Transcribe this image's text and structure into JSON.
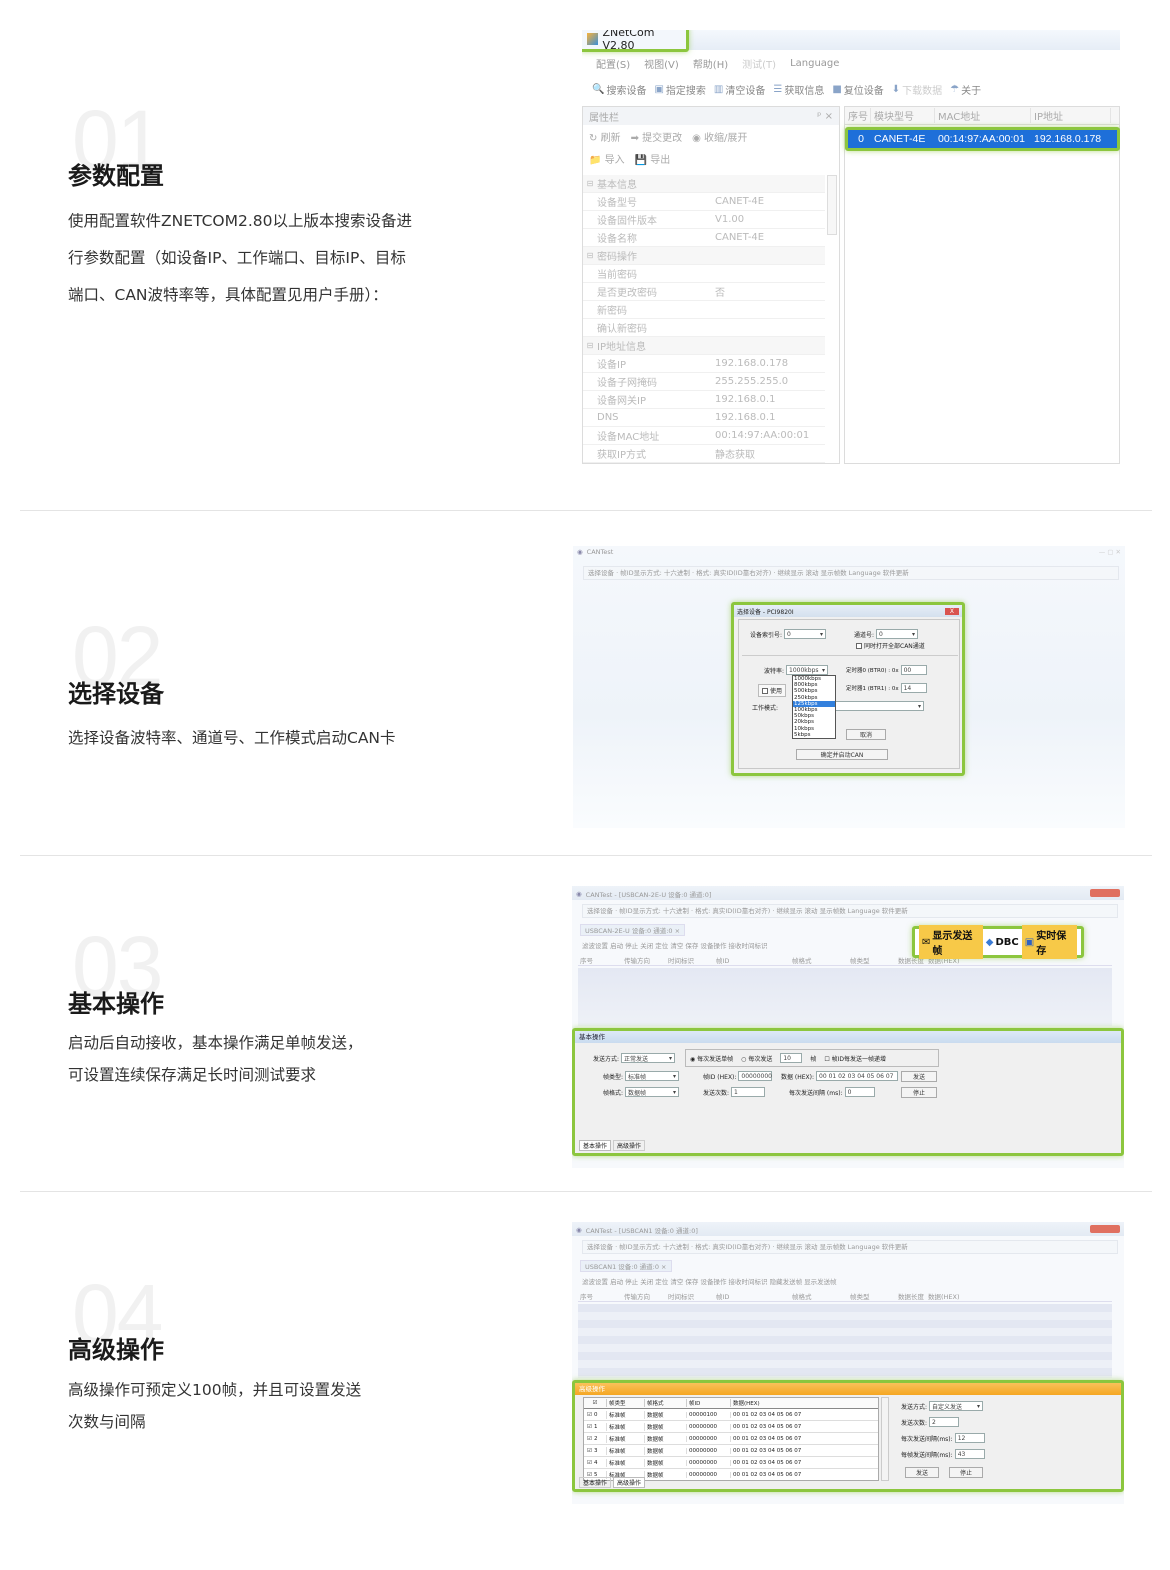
{
  "sections": [
    {
      "num": "01",
      "title": "参数配置",
      "desc": [
        "使用配置软件ZNETCOM2.80以上版本搜索设备进",
        "行参数配置（如设备IP、工作端口、目标IP、目标",
        "端口、CAN波特率等，具体配置见用户手册）："
      ]
    },
    {
      "num": "02",
      "title": "选择设备",
      "desc": [
        "选择设备波特率、通道号、工作模式启动CAN卡"
      ]
    },
    {
      "num": "03",
      "title": "基本操作",
      "desc": [
        "启动后自动接收，基本操作满足单帧发送，",
        "可设置连续保存满足长时间测试要求"
      ]
    },
    {
      "num": "04",
      "title": "高级操作",
      "desc": [
        "高级操作可预定义100帧，并且可设置发送",
        "次数与间隔"
      ]
    }
  ],
  "znet": {
    "title": "ZNetCom V2.80",
    "menu": [
      "配置(S)",
      "视图(V)",
      "帮助(H)",
      "测试(T)",
      "Language"
    ],
    "toolbar": [
      "搜索设备",
      "指定搜索",
      "清空设备",
      "获取信息",
      "复位设备",
      "下载数据",
      "关于"
    ],
    "panel_title": "属性栏",
    "panel_close": "ᵖ ×",
    "panel_tools": [
      "刷新",
      "提交更改",
      "收缩/展开"
    ],
    "panel_tools2": [
      "导入",
      "导出"
    ],
    "props": [
      {
        "group": "基本信息"
      },
      {
        "k": "设备型号",
        "v": "CANET-4E"
      },
      {
        "k": "设备固件版本",
        "v": "V1.00"
      },
      {
        "k": "设备名称",
        "v": "CANET-4E"
      },
      {
        "group": "密码操作"
      },
      {
        "k": "当前密码",
        "v": ""
      },
      {
        "k": "是否更改密码",
        "v": "否"
      },
      {
        "k": "新密码",
        "v": ""
      },
      {
        "k": "确认新密码",
        "v": ""
      },
      {
        "group": "IP地址信息"
      },
      {
        "k": "设备IP",
        "v": "192.168.0.178"
      },
      {
        "k": "设备子网掩码",
        "v": "255.255.255.0"
      },
      {
        "k": "设备网关IP",
        "v": "192.168.0.1"
      },
      {
        "k": "DNS",
        "v": "192.168.0.1"
      },
      {
        "k": "设备MAC地址",
        "v": "00:14:97:AA:00:01"
      },
      {
        "k": "获取IP方式",
        "v": "静态获取"
      }
    ],
    "grid_headers": [
      "序号",
      "模块型号",
      "MAC地址",
      "IP地址"
    ],
    "device_row": {
      "idx": "0",
      "model": "CANET-4E",
      "mac": "00:14:97:AA:00:01",
      "ip": "192.168.0.178"
    }
  },
  "cantest2": {
    "title": "CANTest",
    "toolbar": "选择设备 · 帧ID显示方式: 十六进制 · 格式: 真实ID(ID靠右对齐) · 继续显示 滚动 显示帧数 Language 软件更新",
    "dialog_title": "选择设备 - PCI9820I",
    "close": "X",
    "labels": {
      "index": "设备索引号:",
      "channel": "通道号:",
      "open_all": "同时打开全部CAN通道",
      "baud": "波特率:",
      "use": "使用",
      "timer0": "定时器0 (BTR0) : 0x",
      "timer1": "定时器1 (BTR1) : 0x",
      "mode": "工作模式:",
      "cancel": "取消",
      "confirm": "确定并启动CAN"
    },
    "values": {
      "index": "0",
      "channel": "0",
      "baud": "1000kbps",
      "t0": "00",
      "t1": "14"
    },
    "bauds": [
      "1000kbps",
      "800kbps",
      "500kbps",
      "250kbps",
      "125kbps",
      "100kbps",
      "50kbps",
      "20kbps",
      "10kbps",
      "5kbps"
    ]
  },
  "cantest3": {
    "title": "CANTest - [USBCAN-2E-U 设备:0 通道:0]",
    "toolbar": "选择设备 · 帧ID显示方式: 十六进制 · 格式: 真实ID(ID靠右对齐) · 继续显示 滚动 显示帧数 Language 软件更新",
    "tab": "USBCAN-2E-U 设备:0 通道:0  ×",
    "subtools": "滤波设置  启动  停止  关闭  定位  清空  保存  设备操作  接收时间标识",
    "hl_buttons": [
      "显示发送帧",
      "DBC",
      "实时保存"
    ],
    "cols": [
      "序号",
      "传输方向",
      "时间标识",
      "帧ID",
      "帧格式",
      "帧类型",
      "数据长度",
      "数据(HEX)"
    ],
    "panel_title": "基本操作",
    "labels": {
      "send_mode": "发送方式:",
      "frame_type": "帧类型:",
      "frame_fmt": "帧格式:",
      "once": "每次发送单帧",
      "multi": "每次发送",
      "frames": "帧",
      "incr": "帧ID每发送一帧递增",
      "fid": "帧ID (HEX):",
      "data": "数据 (HEX):",
      "count": "发送次数:",
      "interval": "每次发送间隔 (ms):",
      "send": "发送",
      "stop": "停止"
    },
    "values": {
      "send_mode": "正常发送",
      "frame_type": "标准帧",
      "frame_fmt": "数据帧",
      "multi_n": "10",
      "fid": "00000000",
      "data": "00 01 02 03 04 05 06 07",
      "count": "1",
      "interval": "0"
    },
    "tabs": [
      "基本操作",
      "高级操作"
    ]
  },
  "cantest4": {
    "title": "CANTest - [USBCAN1 设备:0 通道:0]",
    "toolbar": "选择设备 · 帧ID显示方式: 十六进制 · 格式: 真实ID(ID靠右对齐) · 继续显示 滚动 显示帧数 Language 软件更新",
    "tab": "USBCAN1 设备:0 通道:0  ×",
    "subtools": "滤波设置  启动  停止  关闭  定位  清空  保存  设备操作  接收时间标识  隐藏发送帧  显示发送帧",
    "cols": [
      "序号",
      "传输方向",
      "时间标识",
      "帧ID",
      "帧格式",
      "帧类型",
      "数据长度",
      "数据(HEX)"
    ],
    "panel_title": "高级操作",
    "adv_headers": [
      "帧类型",
      "帧格式",
      "帧ID",
      "数据(HEX)"
    ],
    "adv_rows": [
      {
        "i": "0",
        "t": "标准帧",
        "f": "数据帧",
        "id": "00000100",
        "d": "00 01 02 03 04 05 06 07"
      },
      {
        "i": "1",
        "t": "标准帧",
        "f": "数据帧",
        "id": "00000000",
        "d": "00 01 02 03 04 05 06 07"
      },
      {
        "i": "2",
        "t": "标准帧",
        "f": "数据帧",
        "id": "00000000",
        "d": "00 01 02 03 04 05 06 07"
      },
      {
        "i": "3",
        "t": "标准帧",
        "f": "数据帧",
        "id": "00000000",
        "d": "00 01 02 03 04 05 06 07"
      },
      {
        "i": "4",
        "t": "标准帧",
        "f": "数据帧",
        "id": "00000000",
        "d": "00 01 02 03 04 05 06 07"
      },
      {
        "i": "5",
        "t": "标准帧",
        "f": "数据帧",
        "id": "00000000",
        "d": "00 01 02 03 04 05 06 07"
      }
    ],
    "labels": {
      "send_mode": "发送方式:",
      "count": "发送次数:",
      "each_interval": "每次发送间隔(ms):",
      "frame_interval": "每帧发送间隔(ms):",
      "send": "发送",
      "stop": "停止"
    },
    "values": {
      "send_mode": "自定义发送",
      "count": "2",
      "each_interval": "12",
      "frame_interval": "43"
    },
    "tabs": [
      "基本操作",
      "高级操作"
    ]
  },
  "colors": {
    "accent": "#8cc63e",
    "select_blue": "#1e6fd9",
    "title_orange": "#f5a623"
  }
}
